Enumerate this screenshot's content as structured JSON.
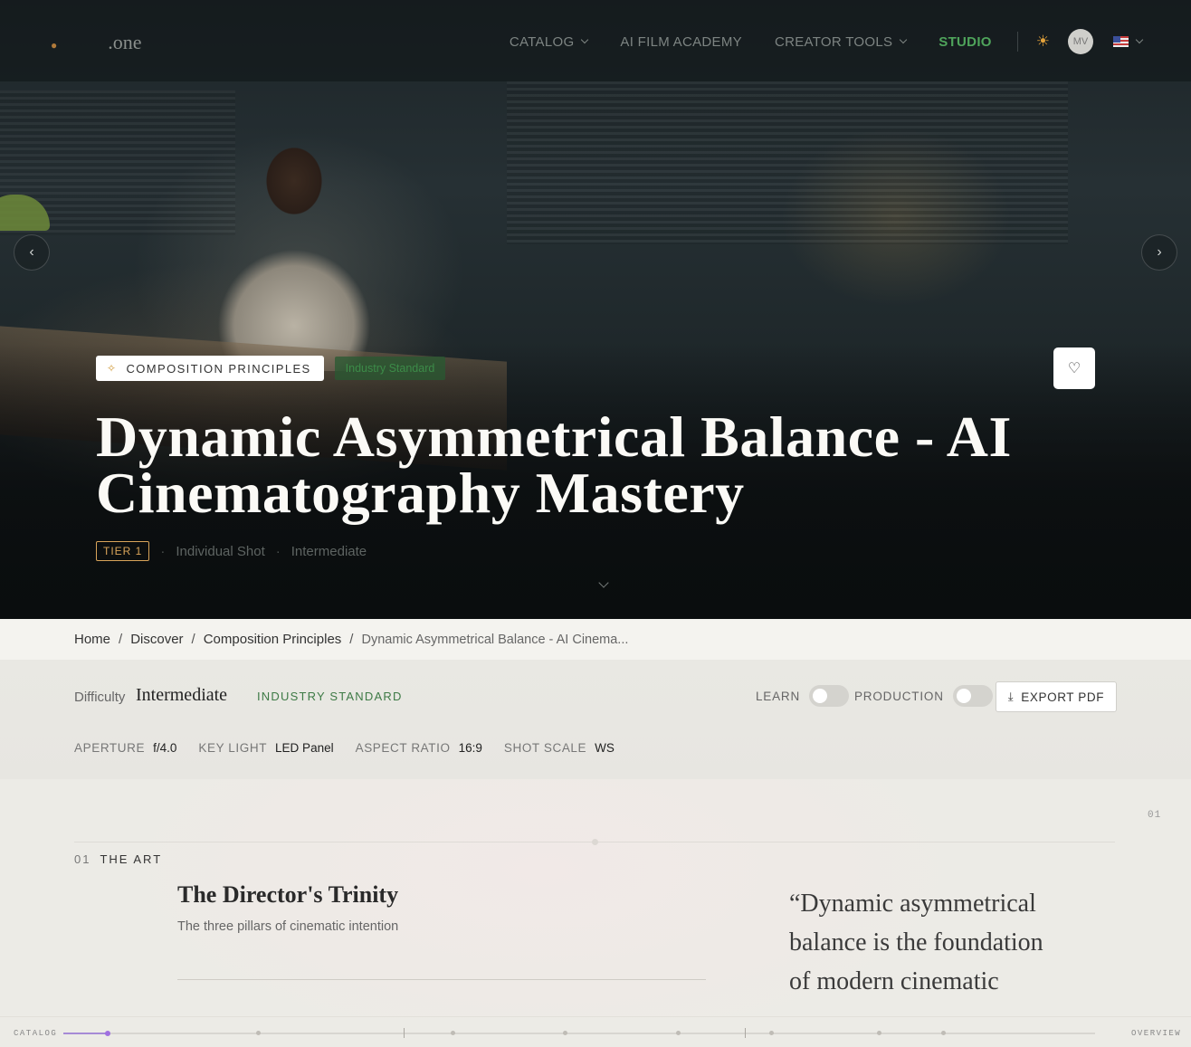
{
  "nav": {
    "logo_suffix": ".one",
    "items": [
      {
        "label": "CATALOG",
        "has_dropdown": true
      },
      {
        "label": "AI FILM ACADEMY",
        "has_dropdown": false
      },
      {
        "label": "CREATOR TOOLS",
        "has_dropdown": true
      },
      {
        "label": "STUDIO",
        "has_dropdown": false
      }
    ],
    "theme_icon": "sun-icon",
    "avatar_initials": "MV",
    "language_icon": "us-flag-icon"
  },
  "hero": {
    "category_tag": "COMPOSITION PRINCIPLES",
    "standard_tag": "Industry Standard",
    "title": "Dynamic Asymmetrical Balance - AI Cinematography Mastery",
    "tier": "TIER 1",
    "shot_type": "Individual Shot",
    "level": "Intermediate"
  },
  "breadcrumb": {
    "items": [
      "Home",
      "Discover",
      "Composition Principles"
    ],
    "current": "Dynamic Asymmetrical Balance - AI Cinema..."
  },
  "toolbar": {
    "difficulty_label": "Difficulty",
    "difficulty_value": "Intermediate",
    "standard_badge": "INDUSTRY STANDARD",
    "learn_label": "LEARN",
    "learn_on": false,
    "production_label": "PRODUCTION",
    "production_on": false,
    "export_label": "EXPORT PDF"
  },
  "specs": [
    {
      "key": "APERTURE",
      "value": "f/4.0"
    },
    {
      "key": "KEY LIGHT",
      "value": "LED Panel"
    },
    {
      "key": "ASPECT RATIO",
      "value": "16:9"
    },
    {
      "key": "SHOT SCALE",
      "value": "WS"
    }
  ],
  "section": {
    "number_right": "01",
    "number": "01",
    "title": "THE ART",
    "card_title": "The Director's Trinity",
    "card_subtitle": "The three pillars of cinematic intention",
    "quote": "“Dynamic asymmetrical balance is the foundation of modern cinematic"
  },
  "progress": {
    "left_label": "CATALOG",
    "right_label": "OVERVIEW",
    "current_fraction": 0.043
  },
  "colors": {
    "accent_green": "#4fa45b",
    "tier_orange": "#d9a45a",
    "progress_purple": "#a070e0"
  }
}
